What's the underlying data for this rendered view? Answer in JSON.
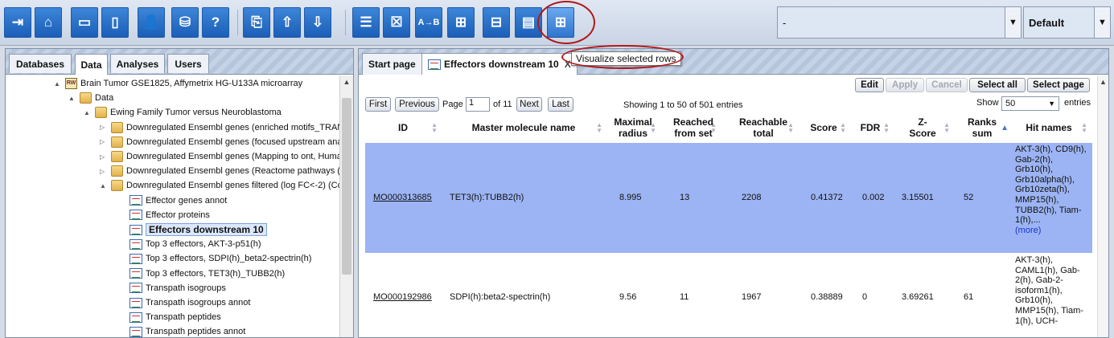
{
  "toolbar": {
    "buttons": [
      {
        "name": "exit-icon",
        "glyph": "⇥"
      },
      {
        "name": "home-icon",
        "glyph": "⌂"
      },
      {
        "name": "split-horizontal-icon",
        "glyph": "▭"
      },
      {
        "name": "panel-icon",
        "glyph": "▯"
      },
      {
        "name": "user-info-icon",
        "glyph": "👤"
      },
      {
        "name": "database-settings-icon",
        "glyph": "⛁"
      },
      {
        "name": "help-icon",
        "glyph": "?"
      },
      {
        "name": "copy-icon",
        "glyph": "⎘"
      },
      {
        "name": "upload-icon",
        "glyph": "⇧"
      },
      {
        "name": "download-icon",
        "glyph": "⇩"
      },
      {
        "name": "add-rows-icon",
        "glyph": "☰"
      },
      {
        "name": "remove-rows-icon",
        "glyph": "☒"
      },
      {
        "name": "rename-icon",
        "glyph": "A→B"
      },
      {
        "name": "network-icon",
        "glyph": "⊞"
      },
      {
        "name": "network-filter-icon",
        "glyph": "⊟"
      },
      {
        "name": "table-view-icon",
        "glyph": "▤"
      },
      {
        "name": "visualize-rows-icon",
        "glyph": "⊞"
      }
    ],
    "path_combo": {
      "value": "-"
    },
    "perspective_combo": {
      "value": "Default"
    }
  },
  "left": {
    "tabs": [
      "Databases",
      "Data",
      "Analyses",
      "Users"
    ],
    "active_tab": "Data",
    "tree": [
      {
        "label": "Brain Tumor GSE1825, Affymetrix HG-U133A microarray",
        "icon": "db",
        "toggle": "▲",
        "indent": 0
      },
      {
        "label": "Data",
        "icon": "folder",
        "toggle": "▲",
        "indent": 1
      },
      {
        "label": "Ewing Family Tumor versus Neuroblastoma",
        "icon": "folder",
        "toggle": "▲",
        "indent": 2
      },
      {
        "label": "Downregulated Ensembl genes (enriched motifs_TRAN",
        "icon": "folder",
        "toggle": "▷",
        "indent": 3
      },
      {
        "label": "Downregulated Ensembl genes (focused upstream ana",
        "icon": "folder",
        "toggle": "▷",
        "indent": 3
      },
      {
        "label": "Downregulated Ensembl genes (Mapping to ont, Human",
        "icon": "folder",
        "toggle": "▷",
        "indent": 3
      },
      {
        "label": "Downregulated Ensembl genes (Reactome pathways (",
        "icon": "folder",
        "toggle": "▷",
        "indent": 3
      },
      {
        "label": "Downregulated Ensembl genes filtered (log FC<-2) (Co",
        "icon": "folder",
        "toggle": "▲",
        "indent": 3
      },
      {
        "label": "Effector genes annot",
        "icon": "dt",
        "toggle": "",
        "indent": 4
      },
      {
        "label": "Effector proteins",
        "icon": "dt",
        "toggle": "",
        "indent": 4
      },
      {
        "label": "Effectors downstream 10",
        "icon": "dt",
        "toggle": "",
        "indent": 4,
        "selected": true
      },
      {
        "label": "Top 3 effectors, AKT-3-p51(h)",
        "icon": "dt",
        "toggle": "",
        "indent": 4
      },
      {
        "label": "Top 3 effectors, SDPI(h)_beta2-spectrin(h)",
        "icon": "dt",
        "toggle": "",
        "indent": 4
      },
      {
        "label": "Top 3 effectors, TET3(h)_TUBB2(h)",
        "icon": "dt",
        "toggle": "",
        "indent": 4
      },
      {
        "label": "Transpath isogroups",
        "icon": "dt",
        "toggle": "",
        "indent": 4
      },
      {
        "label": "Transpath isogroups annot",
        "icon": "dt",
        "toggle": "",
        "indent": 4
      },
      {
        "label": "Transpath peptides",
        "icon": "dt",
        "toggle": "",
        "indent": 4
      },
      {
        "label": "Transpath peptides annot",
        "icon": "dt",
        "toggle": "",
        "indent": 4
      }
    ]
  },
  "right": {
    "tabs": [
      {
        "label": "Start page"
      },
      {
        "label": "Effectors downstream 10",
        "close": "X"
      }
    ],
    "tooltip": "Visualize selected rows",
    "actions": {
      "edit": "Edit",
      "apply": "Apply",
      "cancel": "Cancel",
      "select_all": "Select all",
      "select_page": "Select page"
    },
    "pager": {
      "first": "First",
      "previous": "Previous",
      "page_label": "Page",
      "page_value": "1",
      "of_total": "of 11",
      "next": "Next",
      "last": "Last",
      "showing": "Showing 1 to 50 of 501 entries",
      "show_label": "Show",
      "show_value": "50",
      "entries_label": "entries"
    },
    "columns": [
      "ID",
      "Master molecule name",
      "Maximal radius",
      "Reached from set",
      "Reachable total",
      "Score",
      "FDR",
      "Z-Score",
      "Ranks sum",
      "Hit names"
    ],
    "sorted_column": "Ranks sum",
    "rows": [
      {
        "id": "MO000313685",
        "master": "TET3(h):TUBB2(h)",
        "radius": "8.995",
        "reached": "13",
        "reachable": "2208",
        "score": "0.41372",
        "fdr": "0.002",
        "zscore": "3.15501",
        "ranks": "52",
        "hits": "AKT-3(h), CD9(h), Gab-2(h), Grb10(h), Grb10alpha(h), Grb10zeta(h), MMP15(h), TUBB2(h), Tiam-1(h),...",
        "more": "(more)",
        "selected": true
      },
      {
        "id": "MO000192986",
        "master": "SDPI(h):beta2-spectrin(h)",
        "radius": "9.56",
        "reached": "11",
        "reachable": "1967",
        "score": "0.38889",
        "fdr": "0",
        "zscore": "3.69261",
        "ranks": "61",
        "hits": "AKT-3(h), CAML1(h), Gab-2(h), Gab-2-isoform1(h), Grb10(h), MMP15(h), Tiam-1(h), UCH-",
        "more": "",
        "selected": false
      }
    ]
  },
  "colors": {
    "accent": "#1b5eb8",
    "selection": "#9cb4f3",
    "annotation": "#b01818"
  }
}
